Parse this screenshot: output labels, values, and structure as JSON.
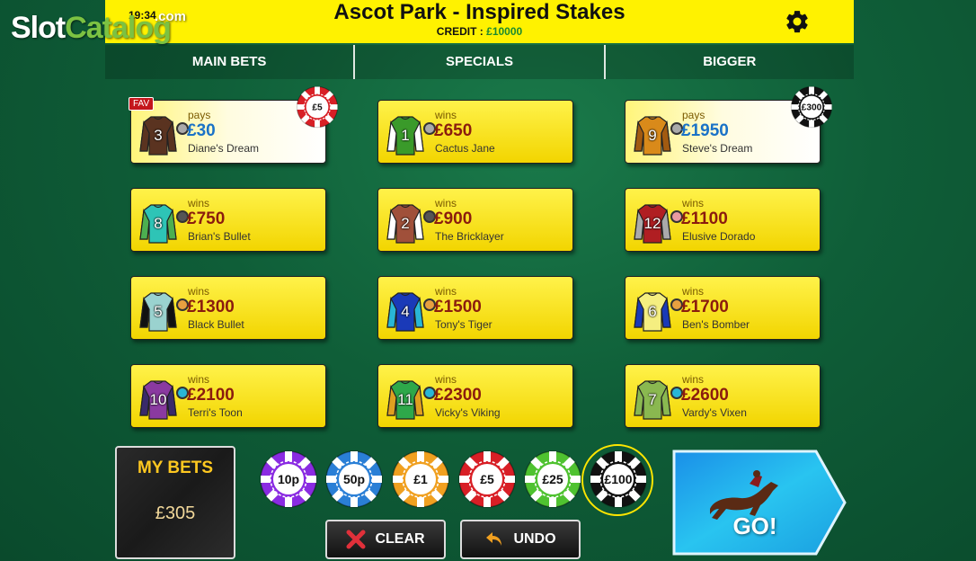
{
  "watermark": {
    "brand_white": "Slot",
    "brand_green": "Catalog",
    "suffix": ".com"
  },
  "header": {
    "clock": "19:34",
    "title": "Ascot Park - Inspired Stakes",
    "credit_label": "CREDIT :",
    "credit_value": "£10000"
  },
  "tabs": [
    {
      "label": "MAIN BETS",
      "active": true
    },
    {
      "label": "SPECIALS",
      "active": false
    },
    {
      "label": "BIGGER",
      "active": false
    }
  ],
  "horses": [
    {
      "number": "3",
      "label": "pays",
      "amount": "£30",
      "name": "Diane's Dream",
      "shirt": "#5a3320",
      "sleeve": "#5a3320",
      "cap": "#aaaaaa",
      "fav": "FAV",
      "selected": true,
      "chip": "£5",
      "chip_color": "#d81f26"
    },
    {
      "number": "1",
      "label": "wins",
      "amount": "£650",
      "name": "Cactus Jane",
      "shirt": "#3a9a2a",
      "sleeve": "#ffffff",
      "cap": "#aaaaaa"
    },
    {
      "number": "9",
      "label": "pays",
      "amount": "£1950",
      "name": "Steve's Dream",
      "shirt": "#d98a1a",
      "sleeve": "#a25a10",
      "cap": "#aaaaaa",
      "selected": true,
      "chip": "£300",
      "chip_color": "#111111"
    },
    {
      "number": "8",
      "label": "wins",
      "amount": "£750",
      "name": "Brian's Bullet",
      "shirt": "#2ec4b6",
      "sleeve": "#4caf50",
      "cap": "#555555"
    },
    {
      "number": "2",
      "label": "wins",
      "amount": "£900",
      "name": "The Bricklayer",
      "shirt": "#a0503a",
      "sleeve": "#ffffff",
      "cap": "#555555"
    },
    {
      "number": "12",
      "label": "wins",
      "amount": "£1100",
      "name": "Elusive Dorado",
      "shirt": "#b01e22",
      "sleeve": "#aaaaaa",
      "cap": "#e89aa0"
    },
    {
      "number": "5",
      "label": "wins",
      "amount": "£1300",
      "name": "Black Bullet",
      "shirt": "#9ad2cf",
      "sleeve": "#111111",
      "cap": "#e8a040"
    },
    {
      "number": "4",
      "label": "wins",
      "amount": "£1500",
      "name": "Tony's Tiger",
      "shirt": "#1a3ab8",
      "sleeve": "#29b6d6",
      "cap": "#e8a040"
    },
    {
      "number": "6",
      "label": "wins",
      "amount": "£1700",
      "name": "Ben's Bomber",
      "shirt": "#f5ee80",
      "sleeve": "#1a3ab8",
      "cap": "#e8a040"
    },
    {
      "number": "10",
      "label": "wins",
      "amount": "£2100",
      "name": "Terri's Toon",
      "shirt": "#8a3aa0",
      "sleeve": "#3a2a6a",
      "cap": "#29b6d6"
    },
    {
      "number": "11",
      "label": "wins",
      "amount": "£2300",
      "name": "Vicky's Viking",
      "shirt": "#2ea84a",
      "sleeve": "#e0a020",
      "cap": "#29b6d6"
    },
    {
      "number": "7",
      "label": "wins",
      "amount": "£2600",
      "name": "Vardy's Vixen",
      "shirt": "#8ab850",
      "sleeve": "#8ab850",
      "cap": "#29b6d6"
    }
  ],
  "my_bets": {
    "title": "MY BETS",
    "value": "£305"
  },
  "chips": [
    {
      "label": "10p",
      "color": "#8a2be2"
    },
    {
      "label": "50p",
      "color": "#2a7fd6"
    },
    {
      "label": "£1",
      "color": "#f0a020"
    },
    {
      "label": "£5",
      "color": "#d81f26"
    },
    {
      "label": "£25",
      "color": "#4fc230"
    },
    {
      "label": "£100",
      "color": "#111111",
      "selected": true
    }
  ],
  "buttons": {
    "clear": "CLEAR",
    "undo": "UNDO",
    "go": "GO!"
  },
  "colors": {
    "header_yellow": "#fff200",
    "card_yellow": "#f2d500",
    "tab_active": "#ffe600",
    "amount_red": "#8a1c0e",
    "amount_blue": "#1a72c7"
  }
}
